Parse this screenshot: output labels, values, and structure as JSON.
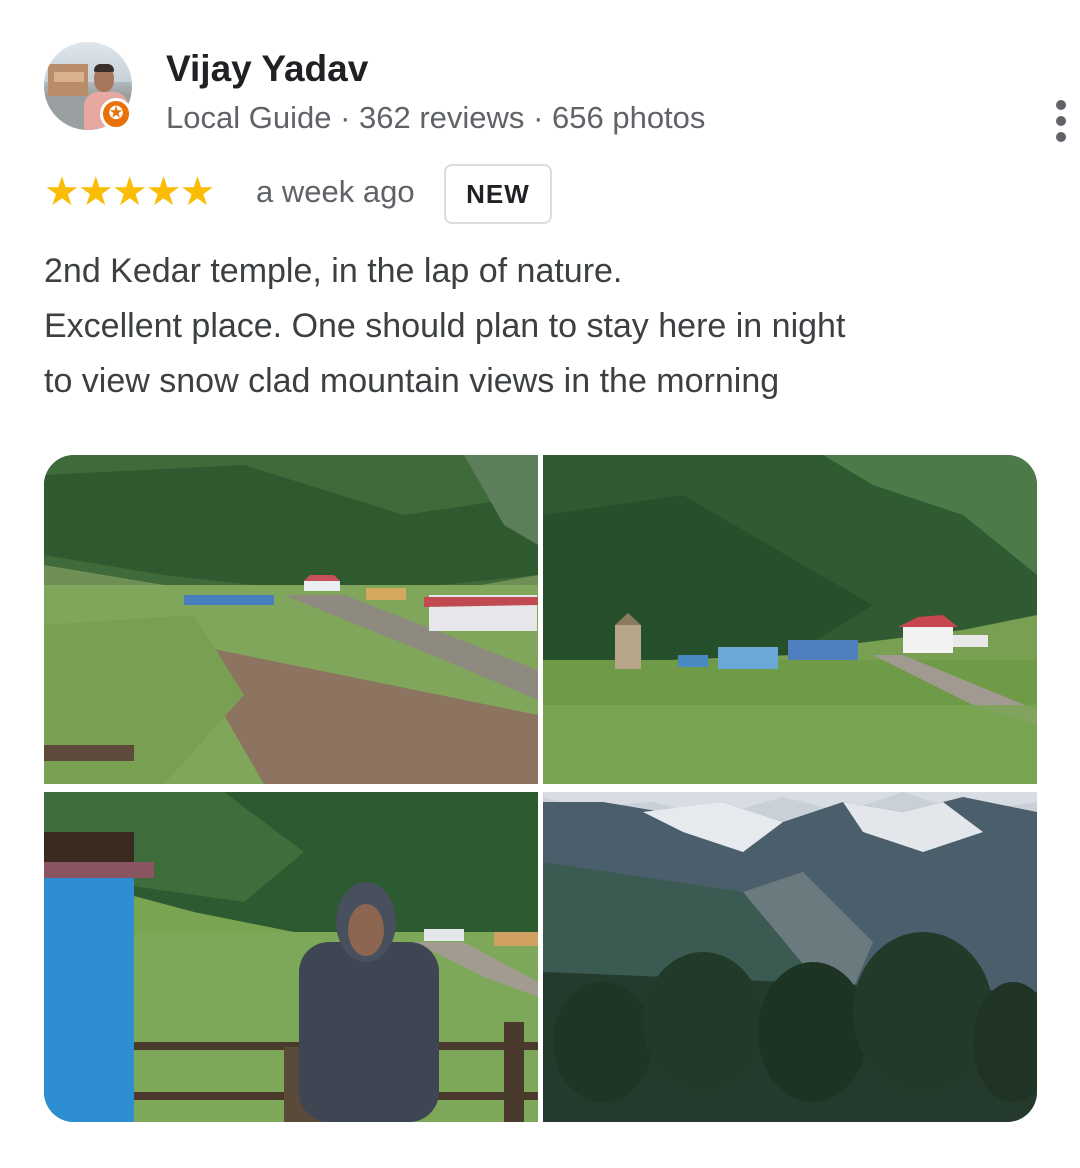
{
  "reviewer": {
    "name": "Vijay Yadav",
    "badge_icon": "local-guide-star-icon",
    "role": "Local Guide",
    "reviews": "362 reviews",
    "photos": "656 photos",
    "separator": "·"
  },
  "rating": {
    "stars": "★★★★★",
    "value": 5,
    "max": 5,
    "time": "a week ago",
    "badge": "NEW"
  },
  "review": {
    "lines": [
      "2nd Kedar temple, in the lap of nature.",
      "Excellent place. One should plan to stay here in night",
      "to view snow clad mountain views in the morning"
    ]
  },
  "colors": {
    "star": "#fbbc04",
    "badge": "#e8710a",
    "secondary_text": "#5f6368"
  },
  "icons": {
    "more": "more-vert-icon"
  }
}
